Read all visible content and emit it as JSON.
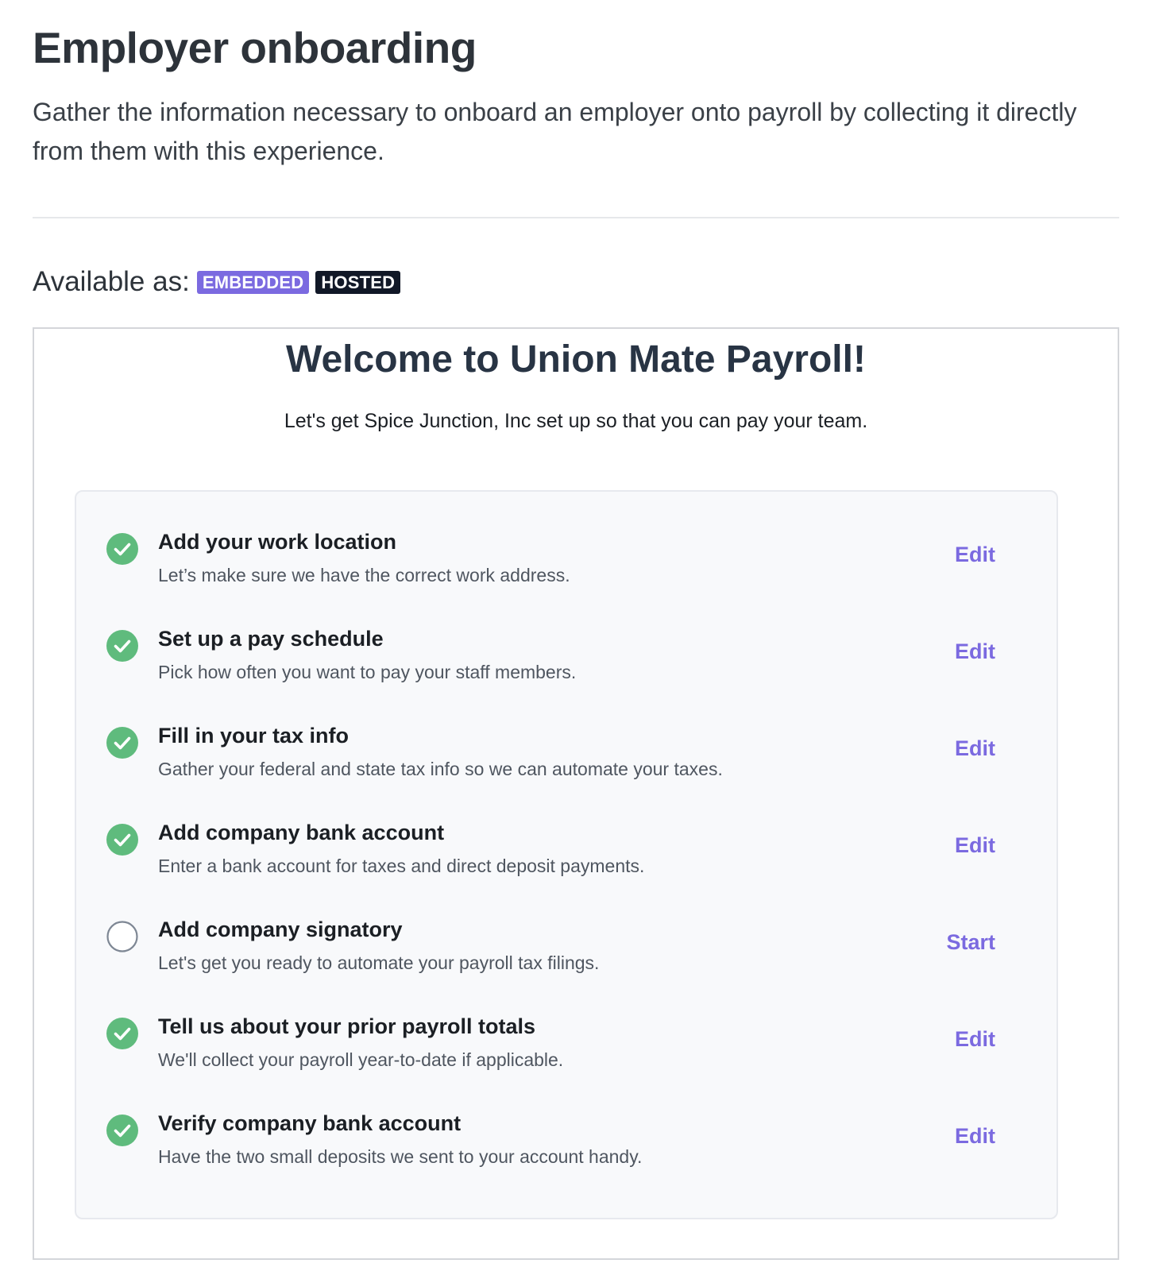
{
  "header": {
    "title": "Employer onboarding",
    "description": "Gather the information necessary to onboard an employer onto payroll by collecting it directly from them with this experience."
  },
  "availability": {
    "label": "Available as:",
    "badges": [
      "EMBEDDED",
      "HOSTED"
    ]
  },
  "colors": {
    "accent": "#7b6ae0",
    "badge_dark": "#111827",
    "complete": "#5fbb7d",
    "pending_ring": "#7e8794"
  },
  "welcome": {
    "title": "Welcome to Union Mate Payroll!",
    "subtitle": "Let's get Spice Junction, Inc set up so that you can pay your team."
  },
  "steps": [
    {
      "title": "Add your work location",
      "description": "Let’s make sure we have the correct work address.",
      "status": "complete",
      "icon": "check-circle-icon",
      "action": "Edit"
    },
    {
      "title": "Set up a pay schedule",
      "description": "Pick how often you want to pay your staff members.",
      "status": "complete",
      "icon": "check-circle-icon",
      "action": "Edit"
    },
    {
      "title": "Fill in your tax info",
      "description": "Gather your federal and state tax info so we can automate your taxes.",
      "status": "complete",
      "icon": "check-circle-icon",
      "action": "Edit"
    },
    {
      "title": "Add company bank account",
      "description": "Enter a bank account for taxes and direct deposit payments.",
      "status": "complete",
      "icon": "check-circle-icon",
      "action": "Edit"
    },
    {
      "title": "Add company signatory",
      "description": "Let's get you ready to automate your payroll tax filings.",
      "status": "pending",
      "icon": "empty-circle-icon",
      "action": "Start"
    },
    {
      "title": "Tell us about your prior payroll totals",
      "description": "We'll collect your payroll year-to-date if applicable.",
      "status": "complete",
      "icon": "check-circle-icon",
      "action": "Edit"
    },
    {
      "title": "Verify company bank account",
      "description": "Have the two small deposits we sent to your account handy.",
      "status": "complete",
      "icon": "check-circle-icon",
      "action": "Edit"
    }
  ]
}
